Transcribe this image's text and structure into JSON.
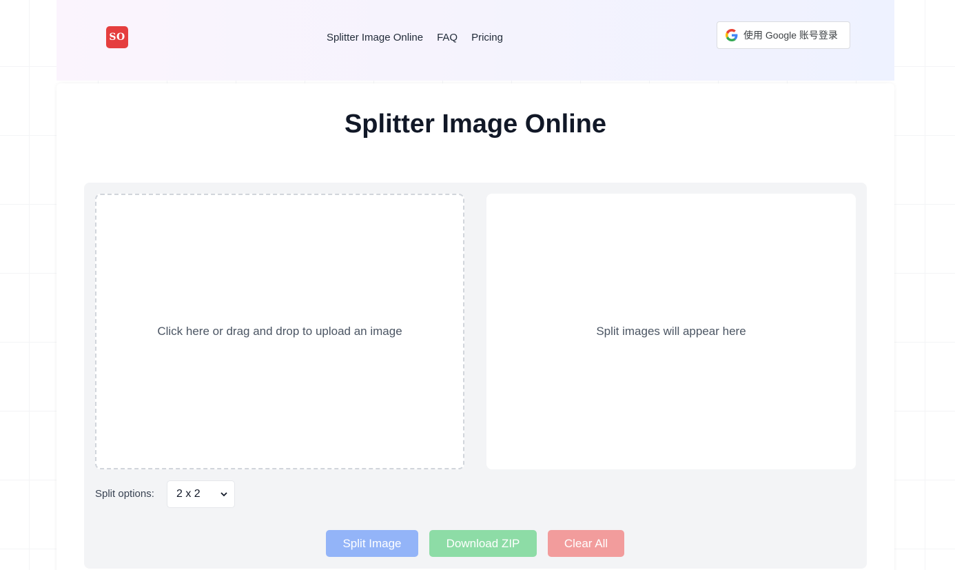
{
  "header": {
    "logo_text": "SO",
    "nav": [
      {
        "label": "Splitter Image Online"
      },
      {
        "label": "FAQ"
      },
      {
        "label": "Pricing"
      }
    ],
    "google_login": {
      "label": "使用 Google 账号登录",
      "icon": "google-g-icon"
    }
  },
  "main": {
    "title": "Splitter Image Online",
    "upload_prompt": "Click here or drag and drop to upload an image",
    "result_placeholder": "Split images will appear here",
    "split_options": {
      "label": "Split options:",
      "selected": "2 x 2"
    },
    "buttons": {
      "split": "Split Image",
      "download": "Download ZIP",
      "clear": "Clear All"
    }
  },
  "colors": {
    "logo": "#e53e3e",
    "split_button": "#93b4f8",
    "download_button": "#8ddca6",
    "clear_button": "#f29c9c"
  }
}
